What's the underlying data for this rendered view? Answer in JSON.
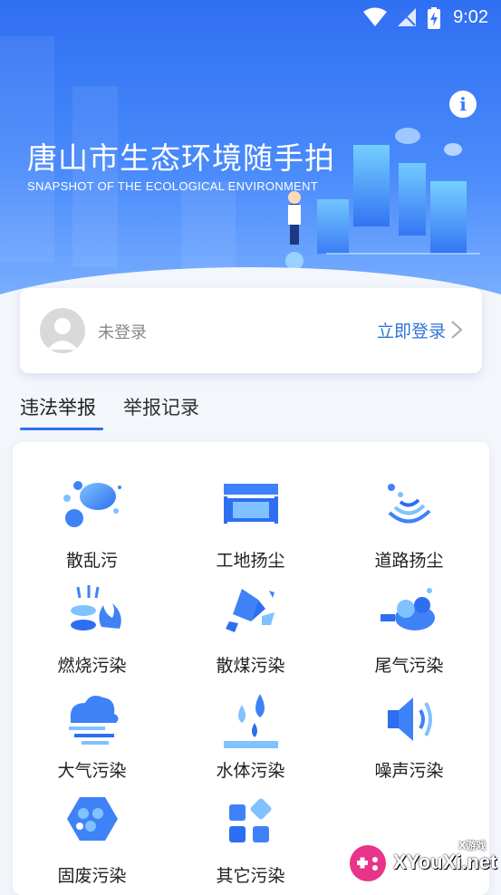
{
  "status_bar": {
    "time": "9:02"
  },
  "hero": {
    "title": "唐山市生态环境随手拍",
    "subtitle": "SNAPSHOT OF THE ECOLOGICAL ENVIRONMENT",
    "info_icon": "info-icon"
  },
  "login": {
    "status": "未登录",
    "action": "立即登录",
    "avatar_icon": "avatar-placeholder-icon",
    "chevron_icon": "chevron-right-icon"
  },
  "tabs": [
    {
      "label": "违法举报",
      "active": true
    },
    {
      "label": "举报记录",
      "active": false
    }
  ],
  "categories": [
    {
      "label": "散乱污",
      "icon": "scattered-dots-icon"
    },
    {
      "label": "工地扬尘",
      "icon": "construction-site-icon"
    },
    {
      "label": "道路扬尘",
      "icon": "road-dust-icon"
    },
    {
      "label": "燃烧污染",
      "icon": "burning-icon"
    },
    {
      "label": "散煤污染",
      "icon": "coal-icon"
    },
    {
      "label": "尾气污染",
      "icon": "exhaust-icon"
    },
    {
      "label": "大气污染",
      "icon": "air-cloud-icon"
    },
    {
      "label": "水体污染",
      "icon": "water-drops-icon"
    },
    {
      "label": "噪声污染",
      "icon": "speaker-icon"
    },
    {
      "label": "固废污染",
      "icon": "solid-waste-icon"
    },
    {
      "label": "其它污染",
      "icon": "other-grid-icon"
    }
  ],
  "watermark": {
    "brand": "XYouXi.net",
    "tag": "X游戏"
  },
  "colors": {
    "primary": "#2f6ff2",
    "icon_blue": "#3b7bf6",
    "background": "#f3f6fb"
  }
}
